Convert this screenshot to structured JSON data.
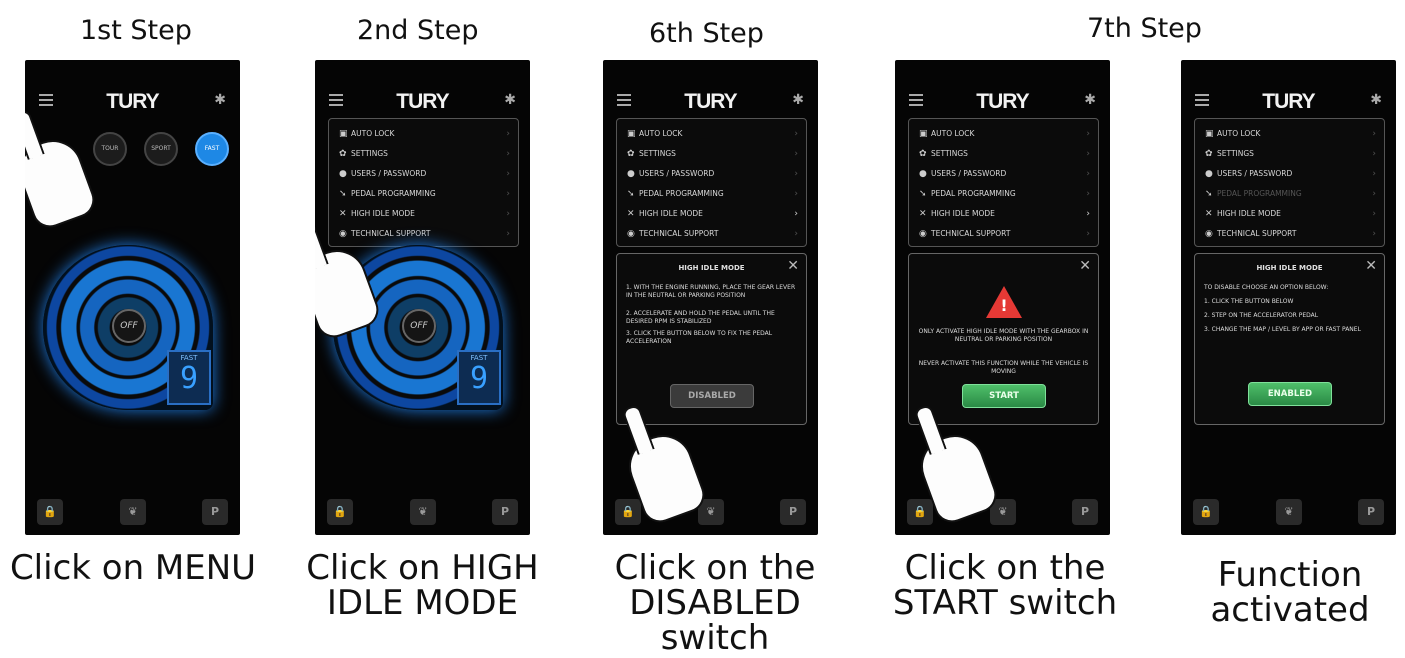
{
  "steps": [
    {
      "title": "1st Step",
      "caption": "Click on MENU"
    },
    {
      "title": "2nd Step",
      "caption": "Click on HIGH IDLE MODE"
    },
    {
      "title": "6th Step",
      "caption": "Click on the DISABLED switch"
    },
    {
      "title": "7th Step",
      "caption_start": "Click on the START switch",
      "caption_done": "Function activated"
    }
  ],
  "app": {
    "brand": "TURY",
    "modes": [
      "TOUR",
      "SPORT",
      "FAST"
    ],
    "dial_center": "OFF",
    "gear_label": "FAST",
    "gear_value": "9",
    "bottom_lock": "🔒",
    "bottom_leaf": "❦",
    "bottom_park": "P"
  },
  "menu": {
    "items": [
      "AUTO LOCK",
      "SETTINGS",
      "USERS / PASSWORD",
      "PEDAL PROGRAMMING",
      "HIGH IDLE MODE",
      "TECHNICAL SUPPORT"
    ]
  },
  "dialog_instructions": {
    "title": "HIGH IDLE MODE",
    "line1": "1. WITH THE ENGINE RUNNING, PLACE THE GEAR LEVER IN THE NEUTRAL OR PARKING POSITION",
    "line2": "2. ACCELERATE AND HOLD THE PEDAL UNTIL THE DESIRED RPM IS STABILIZED",
    "line3": "3. CLICK THE BUTTON BELOW TO FIX THE PEDAL ACCELERATION",
    "button": "DISABLED"
  },
  "dialog_warning": {
    "line1": "ONLY ACTIVATE HIGH IDLE MODE WITH THE GEARBOX IN NEUTRAL OR PARKING POSITION",
    "line2": "NEVER ACTIVATE THIS FUNCTION WHILE THE VEHICLE IS MOVING",
    "button": "START"
  },
  "dialog_enabled": {
    "title": "HIGH IDLE MODE",
    "line0": "TO DISABLE CHOOSE AN OPTION BELOW:",
    "line1": "1. CLICK THE BUTTON BELOW",
    "line2": "2. STEP ON THE ACCELERATOR PEDAL",
    "line3": "3. CHANGE THE MAP / LEVEL BY APP OR FAST PANEL",
    "button": "ENABLED"
  },
  "icons": {
    "menu": "hamburger-icon",
    "bluetooth": "bluetooth-icon",
    "close": "close-icon",
    "chevron": "chevron-right-icon",
    "hand": "pointing-hand-icon",
    "warning": "warning-triangle-icon"
  }
}
